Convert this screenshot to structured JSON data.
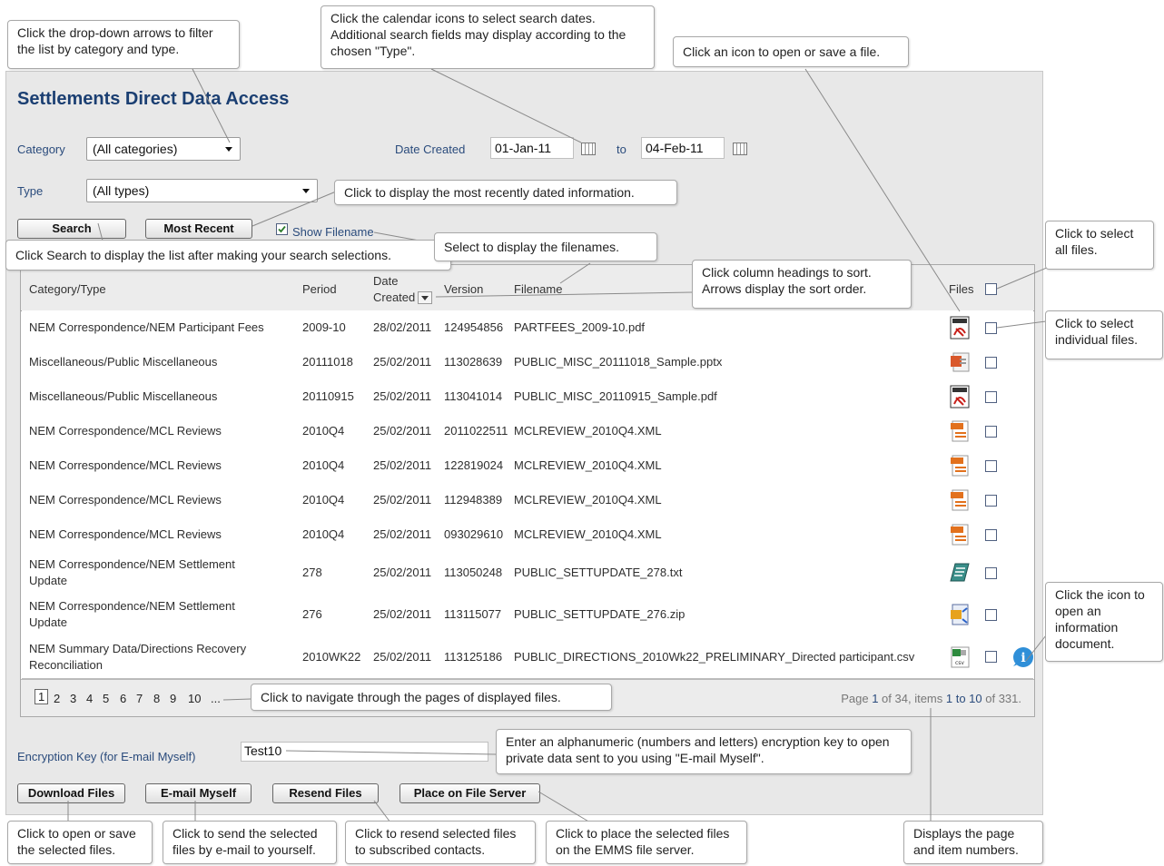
{
  "title": "Settlements Direct Data Access",
  "filters": {
    "category_label": "Category",
    "category_value": "(All categories)",
    "type_label": "Type",
    "type_value": "(All types)",
    "date_created_label": "Date Created",
    "date_from": "01-Jan-11",
    "date_to_label": "to",
    "date_to": "04-Feb-11"
  },
  "buttons": {
    "search": "Search",
    "most_recent": "Most Recent",
    "show_filename": "Show Filename",
    "download": "Download Files",
    "email": "E-mail Myself",
    "resend": "Resend Files",
    "file_server": "Place on File Server"
  },
  "encryption": {
    "label": "Encryption Key (for E-mail Myself)",
    "value": "Test10"
  },
  "table": {
    "headers": {
      "category": "Category/Type",
      "period": "Period",
      "date_line1": "Date",
      "date_line2": "Created",
      "version": "Version",
      "filename": "Filename",
      "files": "Files"
    },
    "rows": [
      {
        "category": "NEM Correspondence/NEM Participant Fees",
        "period": "2009-10",
        "date": "28/02/2011",
        "version": "124954856",
        "filename": "PARTFEES_2009-10.pdf",
        "icon": "pdf-icon"
      },
      {
        "category": "Miscellaneous/Public Miscellaneous",
        "period": "20111018",
        "date": "25/02/2011",
        "version": "113028639",
        "filename": "PUBLIC_MISC_20111018_Sample.pptx",
        "icon": "pptx-icon"
      },
      {
        "category": "Miscellaneous/Public Miscellaneous",
        "period": "20110915",
        "date": "25/02/2011",
        "version": "113041014",
        "filename": "PUBLIC_MISC_20110915_Sample.pdf",
        "icon": "pdf-icon"
      },
      {
        "category": "NEM Correspondence/MCL Reviews",
        "period": "2010Q4",
        "date": "25/02/2011",
        "version": "2011022511",
        "filename": "MCLREVIEW_2010Q4.XML",
        "icon": "xml-icon"
      },
      {
        "category": "NEM Correspondence/MCL Reviews",
        "period": "2010Q4",
        "date": "25/02/2011",
        "version": "122819024",
        "filename": "MCLREVIEW_2010Q4.XML",
        "icon": "xml-icon"
      },
      {
        "category": "NEM Correspondence/MCL Reviews",
        "period": "2010Q4",
        "date": "25/02/2011",
        "version": "112948389",
        "filename": "MCLREVIEW_2010Q4.XML",
        "icon": "xml-icon"
      },
      {
        "category": "NEM Correspondence/MCL Reviews",
        "period": "2010Q4",
        "date": "25/02/2011",
        "version": "093029610",
        "filename": "MCLREVIEW_2010Q4.XML",
        "icon": "xml-icon"
      },
      {
        "category": "NEM Correspondence/NEM Settlement",
        "category2": "Update",
        "period": "278",
        "date": "25/02/2011",
        "version": "113050248",
        "filename": "PUBLIC_SETTUPDATE_278.txt",
        "icon": "txt-icon"
      },
      {
        "category": "NEM Correspondence/NEM Settlement",
        "category2": "Update",
        "period": "276",
        "date": "25/02/2011",
        "version": "113115077",
        "filename": "PUBLIC_SETTUPDATE_276.zip",
        "icon": "zip-icon"
      },
      {
        "category": "NEM Summary Data/Directions Recovery",
        "category2": "Reconciliation",
        "period": "2010WK22",
        "date": "25/02/2011",
        "version": "113125186",
        "filename": "PUBLIC_DIRECTIONS_2010Wk22_PRELIMINARY_Directed participant.csv",
        "icon": "csv-icon"
      }
    ]
  },
  "pager": {
    "pages": [
      "1",
      "2",
      "3",
      "4",
      "5",
      "6",
      "7",
      "8",
      "9",
      "10",
      "..."
    ],
    "page_word": "Page ",
    "page": "1",
    "of_pages": " of 34, ",
    "items_word": "items ",
    "items": "1 to 10",
    "of_items": " of 331."
  },
  "callouts": {
    "dropdown": "Click the drop-down arrows to filter the list by category and type.",
    "calendar": "Click the calendar icons to select search dates. Additional search fields may display according to the chosen \"Type\".",
    "icon_open": "Click an icon to open or save a file.",
    "most_recent": "Click to display the most recently dated information.",
    "search": "Click Search to display the list after making your search selections.",
    "filenames": "Select to display the filenames.",
    "sort": "Click column headings to sort. Arrows display the sort order.",
    "select_all": "Click to select all files.",
    "select_individual": "Click to select individual files.",
    "info": "Click the icon to open an information document.",
    "navigate": "Click to navigate through the pages of displayed files.",
    "encryption": "Enter an alphanumeric (numbers and letters) encryption key to open private data sent to you using \"E-mail Myself\".",
    "download": "Click to open or save the selected files.",
    "email": "Click to send the selected files by e-mail to yourself.",
    "resend": "Click to resend selected files to subscribed contacts.",
    "file_server": "Click to place the selected files on the EMMS file server.",
    "page_numbers": "Displays the page and item numbers."
  }
}
